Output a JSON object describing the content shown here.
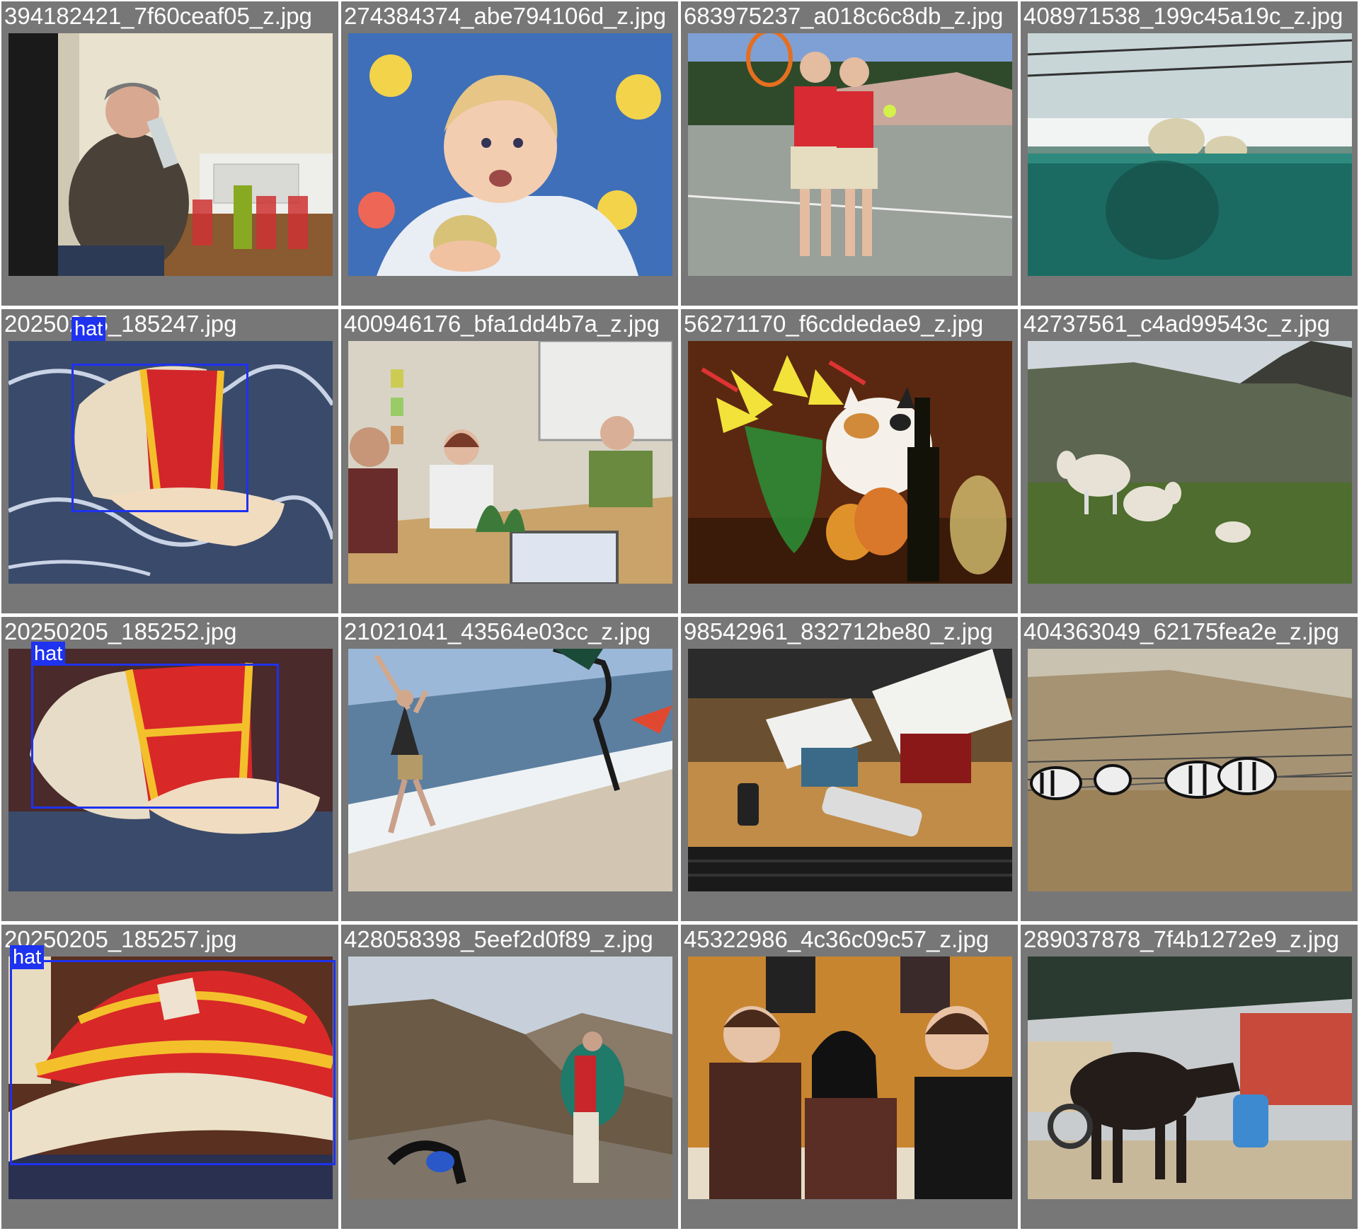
{
  "tiles": [
    {
      "filename": "394182421_7f60ceaf05_z.jpg",
      "scene": "kitchen-drink"
    },
    {
      "filename": "274384374_abe794106d_z.jpg",
      "scene": "baby-eating"
    },
    {
      "filename": "683975237_a018c6c8db_z.jpg",
      "scene": "kids-tennis"
    },
    {
      "filename": "408971538_199c45a19c_z.jpg",
      "scene": "polar-bear-pool"
    },
    {
      "filename": "20250205_185247.jpg",
      "scene": "cap-1",
      "detection": {
        "label": "hat"
      }
    },
    {
      "filename": "400946176_bfa1dd4b7a_z.jpg",
      "scene": "office-meeting"
    },
    {
      "filename": "56271170_f6cddedae9_z.jpg",
      "scene": "cat-flowers"
    },
    {
      "filename": "42737561_c4ad99543c_z.jpg",
      "scene": "sheep-mountain"
    },
    {
      "filename": "20250205_185252.jpg",
      "scene": "cap-2",
      "detection": {
        "label": "hat"
      }
    },
    {
      "filename": "21021041_43564e03cc_z.jpg",
      "scene": "beach"
    },
    {
      "filename": "98542961_832712be80_z.jpg",
      "scene": "messy-desk"
    },
    {
      "filename": "404363049_62175fea2e_z.jpg",
      "scene": "zebras"
    },
    {
      "filename": "20250205_185257.jpg",
      "scene": "cap-3",
      "detection": {
        "label": "hat"
      }
    },
    {
      "filename": "428058398_5eef2d0f89_z.jpg",
      "scene": "hiker-dog"
    },
    {
      "filename": "45322986_4c36c09c57_z.jpg",
      "scene": "restaurant"
    },
    {
      "filename": "289037878_7f4b1272e9_z.jpg",
      "scene": "cow-market"
    }
  ]
}
